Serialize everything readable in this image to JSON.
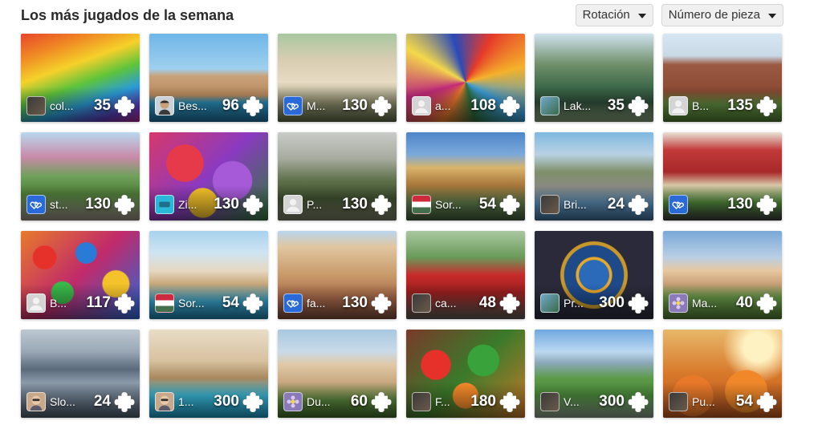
{
  "header": {
    "title": "Los más jugados de la semana",
    "sort_rotation_label": "Rotación",
    "sort_pieces_label": "Número de pieza"
  },
  "icons": {
    "caret": "chevron-down-icon",
    "piece": "puzzle-piece-icon"
  },
  "puzzles": [
    {
      "user": "col...",
      "pieces": "35",
      "avatar": "dark",
      "art": "rainbow-paint"
    },
    {
      "user": "Bes...",
      "pieces": "96",
      "avatar": "person",
      "art": "sea-rocks"
    },
    {
      "user": "M...",
      "pieces": "130",
      "avatar": "hearts",
      "art": "patio-house"
    },
    {
      "user": "a...",
      "pieces": "108",
      "avatar": "default",
      "art": "mosaic"
    },
    {
      "user": "Lak...",
      "pieces": "35",
      "avatar": "photo",
      "art": "lake-cabin"
    },
    {
      "user": "B...",
      "pieces": "135",
      "avatar": "default",
      "art": "manor"
    },
    {
      "user": "st...",
      "pieces": "130",
      "avatar": "hearts",
      "art": "flower-street"
    },
    {
      "user": "Zi...",
      "pieces": "130",
      "avatar": "cyan",
      "art": "zinnias"
    },
    {
      "user": "P...",
      "pieces": "130",
      "avatar": "default",
      "art": "stone-bridge"
    },
    {
      "user": "Sor...",
      "pieces": "54",
      "avatar": "flag-hu",
      "art": "sorrento-cliffs"
    },
    {
      "user": "Bri...",
      "pieces": "24",
      "avatar": "dark",
      "art": "canal-town"
    },
    {
      "user": "",
      "pieces": "130",
      "avatar": "hearts",
      "art": "entrecote-cafe"
    },
    {
      "user": "B...",
      "pieces": "117",
      "avatar": "default",
      "art": "buttons"
    },
    {
      "user": "Sor...",
      "pieces": "54",
      "avatar": "flag-hu",
      "art": "coast-town"
    },
    {
      "user": "fa...",
      "pieces": "130",
      "avatar": "hearts",
      "art": "building-facade"
    },
    {
      "user": "ca...",
      "pieces": "48",
      "avatar": "dark",
      "art": "red-car"
    },
    {
      "user": "Pr...",
      "pieces": "300",
      "avatar": "photo",
      "art": "astro-clock"
    },
    {
      "user": "Ma...",
      "pieces": "40",
      "avatar": "flower",
      "art": "castle"
    },
    {
      "user": "Slo...",
      "pieces": "24",
      "avatar": "face",
      "art": "lake-bled"
    },
    {
      "user": "1...",
      "pieces": "300",
      "avatar": "face",
      "art": "villa-pool"
    },
    {
      "user": "Du...",
      "pieces": "60",
      "avatar": "flower",
      "art": "palace-garden"
    },
    {
      "user": "F...",
      "pieces": "180",
      "avatar": "dark",
      "art": "vegetables"
    },
    {
      "user": "V...",
      "pieces": "300",
      "avatar": "dark",
      "art": "valley-road"
    },
    {
      "user": "Pu...",
      "pieces": "54",
      "avatar": "dark",
      "art": "pumpkins"
    }
  ]
}
